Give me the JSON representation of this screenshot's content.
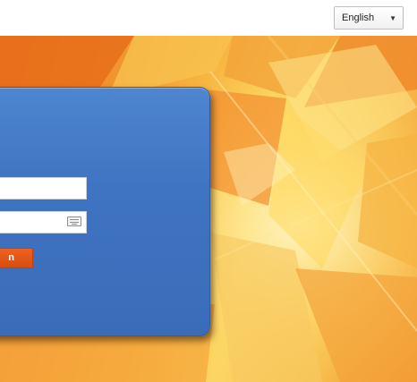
{
  "language_selector": {
    "selected": "English",
    "caret_icon": "caret-down-icon"
  },
  "login_form": {
    "username_value": "",
    "password_value": "",
    "keyboard_icon": "keyboard-icon",
    "submit_label_fragment": "n"
  },
  "colors": {
    "panel_blue": "#3f74c2",
    "button_orange": "#e8571a",
    "background_orange": "#f19a33",
    "background_yellow": "#fbd667"
  }
}
